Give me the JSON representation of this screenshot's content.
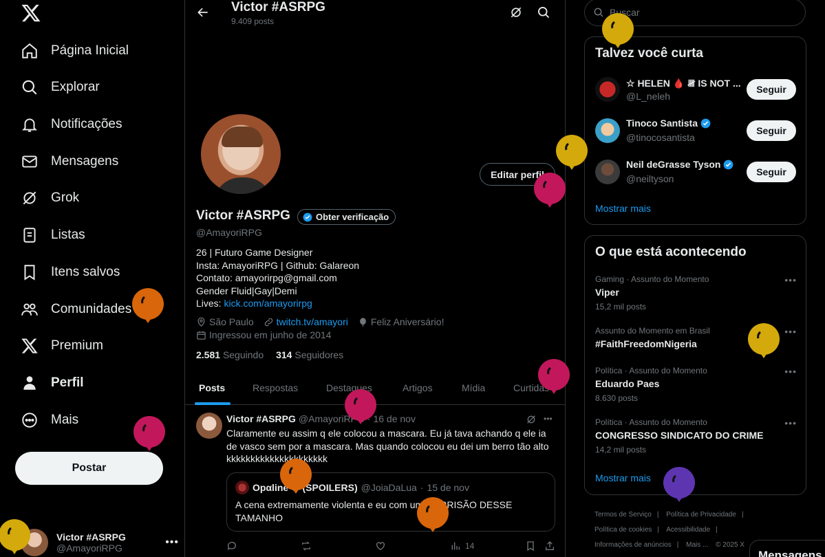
{
  "nav": {
    "items": [
      {
        "label": "Página Inicial",
        "icon": "home-icon"
      },
      {
        "label": "Explorar",
        "icon": "search-icon"
      },
      {
        "label": "Notificações",
        "icon": "bell-icon"
      },
      {
        "label": "Mensagens",
        "icon": "envelope-icon"
      },
      {
        "label": "Grok",
        "icon": "grok-icon"
      },
      {
        "label": "Listas",
        "icon": "list-icon"
      },
      {
        "label": "Itens salvos",
        "icon": "bookmark-icon"
      },
      {
        "label": "Comunidades",
        "icon": "communities-icon"
      },
      {
        "label": "Premium",
        "icon": "x-logo-icon"
      },
      {
        "label": "Perfil",
        "icon": "person-icon"
      },
      {
        "label": "Mais",
        "icon": "more-circle-icon"
      }
    ],
    "post_button": "Postar",
    "account": {
      "name": "Victor #ASRPG",
      "handle": "@AmayoriRPG"
    }
  },
  "header": {
    "name": "Victor #ASRPG",
    "post_count": "9.409 posts"
  },
  "profile": {
    "name": "Victor #ASRPG",
    "verify_button": "Obter verificação",
    "handle": "@AmayoriRPG",
    "edit_button": "Editar perfil",
    "bio": {
      "line1": "26 | Futuro Game Designer",
      "line2": "Insta: AmayoriRPG | Github: Galareon",
      "line3": "Contato: amayorirpg@gmail.com",
      "line4": "Gender Fluid|Gay|Demi",
      "line5_prefix": "Lives: ",
      "line5_link": "kick.com/amayorirpg"
    },
    "location": "São Paulo",
    "website": "twitch.tv/amayori",
    "birthday": "Feliz Aniversário!",
    "joined": "Ingressou em junho de 2014",
    "following_count": "2.581",
    "following_label": "Seguindo",
    "followers_count": "314",
    "followers_label": "Seguidores"
  },
  "tabs": [
    "Posts",
    "Respostas",
    "Destaques",
    "Artigos",
    "Mídia",
    "Curtidas"
  ],
  "tweet": {
    "name": "Victor #ASRPG",
    "handle": "@AmayoriRPG",
    "sep": "·",
    "date": "16 de nov",
    "text": "Claramente eu assim q ele colocou a mascara. Eu já tava achando q ele ia de vasco sem por a mascara. Mas quando colocou eu dei um berro tão alto kkkkkkkkkkkkkkkkkkkkk",
    "quote": {
      "name": "Opαline ☾ (SPOILERS)",
      "handle": "@JoiaDaLua",
      "date": "15 de nov",
      "text": "A cena extremamente violenta e eu com um SORRISÃO DESSE TAMANHO"
    },
    "views": "14"
  },
  "right": {
    "search_placeholder": "Buscar",
    "wtf_title": "Talvez você curta",
    "wtf": [
      {
        "name": "☆ HELEN 🩸 𝍸 IS NOT ...",
        "handle": "@L_neleh",
        "verified": false,
        "button": "Seguir"
      },
      {
        "name": "Tinoco Santista",
        "handle": "@tinocosantista",
        "verified": true,
        "button": "Seguir"
      },
      {
        "name": "Neil deGrasse Tyson",
        "handle": "@neiltyson",
        "verified": true,
        "button": "Seguir"
      }
    ],
    "show_more": "Mostrar mais",
    "trends_title": "O que está acontecendo",
    "trends": [
      {
        "context": "Gaming · Assunto do Momento",
        "topic": "Viper",
        "count": "15,2 mil posts"
      },
      {
        "context": "Assunto do Momento em Brasil",
        "topic": "#FaithFreedomNigeria",
        "count": ""
      },
      {
        "context": "Política · Assunto do Momento",
        "topic": "Eduardo Paes",
        "count": "8.630 posts"
      },
      {
        "context": "Política · Assunto do Momento",
        "topic": "CONGRESSO SINDICATO DO CRIME",
        "count": "14,2 mil posts"
      }
    ],
    "trends_show_more": "Mostrar mais",
    "footer": [
      "Termos de Serviço",
      "Política de Privacidade",
      "Política de cookies",
      "Acessibilidade",
      "Informações de anúncios",
      "Mais ...",
      "© 2025 X"
    ],
    "messages_tab": "Mensagens"
  },
  "colors": {
    "accent": "#1d9bf0",
    "balloon_yellow": "#d4a90c",
    "balloon_pink": "#c2185b",
    "balloon_orange": "#d9660a",
    "balloon_purple": "#5e35b1"
  }
}
